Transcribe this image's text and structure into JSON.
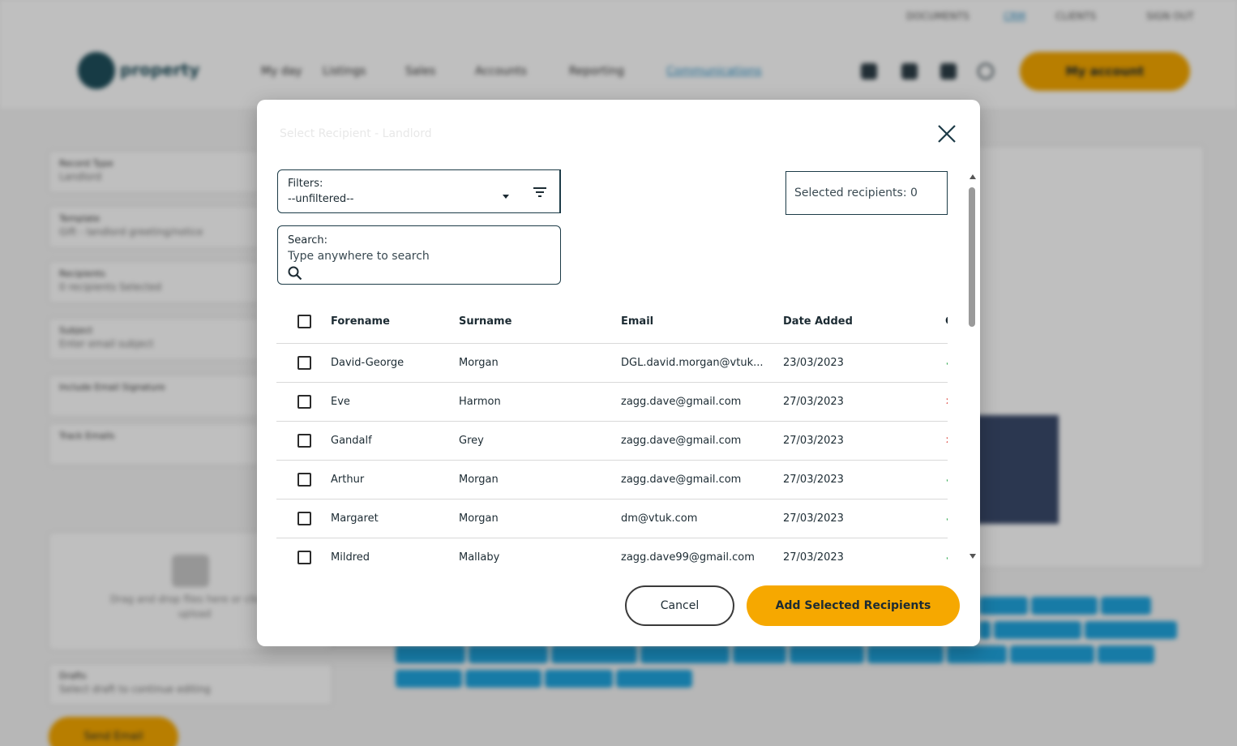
{
  "background": {
    "top_links": [
      "DOCUMENTS",
      "CRM",
      "CLIENTS",
      "SIGN OUT"
    ],
    "logo_text": "property",
    "nav_items": [
      "My day",
      "Listings",
      "Sales",
      "Accounts",
      "Reporting",
      "Communications"
    ],
    "my_account_label": "My account",
    "fields": [
      {
        "label": "Record Type",
        "value": "Landlord"
      },
      {
        "label": "Template",
        "value": "Gift - landlord greeting/notice"
      },
      {
        "label": "Recipients",
        "value": "0 recipients Selected"
      },
      {
        "label": "Subject",
        "value": "Enter email subject"
      },
      {
        "label": "Include Email Signature",
        "value": ""
      },
      {
        "label": "Track Emails",
        "value": ""
      }
    ],
    "upload_text": "Drag and drop files here or click to upload",
    "drafts_label": "Drafts",
    "drafts_value": "Select draft to continue editing",
    "save_label": "Send Email"
  },
  "modal": {
    "title": "Select Recipient - Landlord",
    "filter": {
      "label": "Filters:",
      "value": "--unfiltered--"
    },
    "search": {
      "label": "Search:",
      "placeholder": "Type anywhere to search"
    },
    "selected_recipients_text": "Selected recipients: 0",
    "table": {
      "columns": [
        "Forename",
        "Surname",
        "Email",
        "Date Added",
        "C"
      ],
      "rows": [
        {
          "forename": "David-George",
          "surname": "Morgan",
          "email": "DGL.david.morgan@vtuk...",
          "date_added": "23/03/2023",
          "status": "✓",
          "status_ok": true
        },
        {
          "forename": "Eve",
          "surname": "Harmon",
          "email": "zagg.dave@gmail.com",
          "date_added": "27/03/2023",
          "status": "✕",
          "status_ok": false
        },
        {
          "forename": "Gandalf",
          "surname": "Grey",
          "email": "zagg.dave@gmail.com",
          "date_added": "27/03/2023",
          "status": "✕",
          "status_ok": false
        },
        {
          "forename": "Arthur",
          "surname": "Morgan",
          "email": "zagg.dave@gmail.com",
          "date_added": "27/03/2023",
          "status": "✓",
          "status_ok": true
        },
        {
          "forename": "Margaret",
          "surname": "Morgan",
          "email": "dm@vtuk.com",
          "date_added": "27/03/2023",
          "status": "✓",
          "status_ok": true
        },
        {
          "forename": "Mildred",
          "surname": "Mallaby",
          "email": "zagg.dave99@gmail.com",
          "date_added": "27/03/2023",
          "status": "✓",
          "status_ok": true
        }
      ]
    },
    "buttons": {
      "cancel": "Cancel",
      "add": "Add Selected Recipients"
    }
  },
  "colors": {
    "accent": "#f6a800",
    "border": "#1c3b47",
    "tag": "#1fa4de",
    "ok": "#2fa84f",
    "error": "#d9342b"
  }
}
